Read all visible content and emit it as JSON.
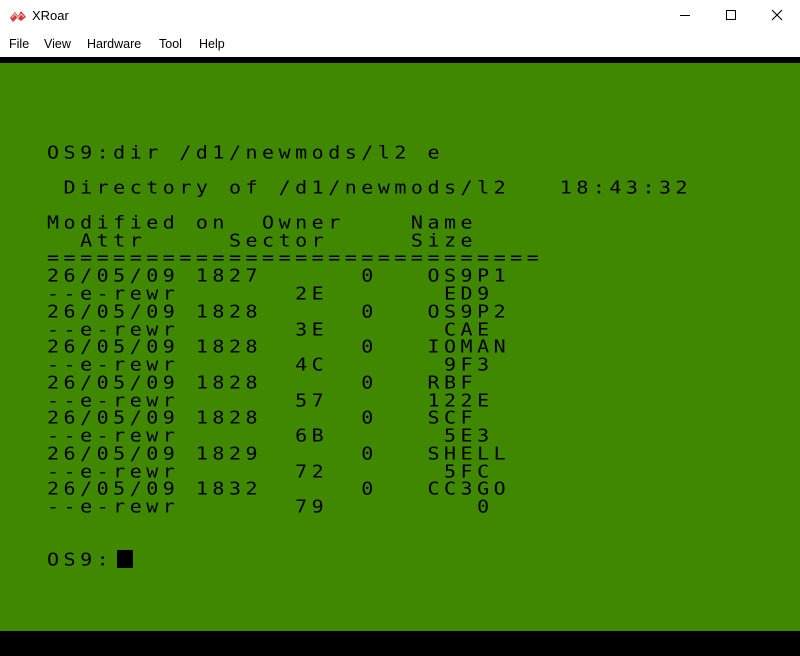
{
  "window": {
    "title": "XRoar",
    "icon": "xroar-app-icon",
    "controls": [
      "minimize-icon",
      "maximize-icon",
      "close-icon"
    ]
  },
  "menu": [
    "File",
    "View",
    "Hardware",
    "Tool",
    "Help"
  ],
  "screen": {
    "background_color": "#3f8800",
    "text_color": "#000000",
    "lines": [
      "OS9:dir /d1/newmods/l2 e",
      " Directory of /d1/newmods/l2   18:43:32",
      "Modified on  Owner    Name",
      "  Attr     Sector     Size",
      "==============================",
      "26/05/09 1827      0   OS9P1",
      "--e-rewr       2E       ED9",
      "26/05/09 1828      0   OS9P2",
      "--e-rewr       3E       CAE",
      "26/05/09 1828      0   IOMAN",
      "--e-rewr       4C       9F3",
      "26/05/09 1828      0   RBF",
      "--e-rewr       57      122E",
      "26/05/09 1828      0   SCF",
      "--e-rewr       6B       5E3",
      "26/05/09 1829      0   SHELL",
      "--e-rewr       72       5FC",
      "26/05/09 1832      0   CC3GO",
      "--e-rewr       79         0"
    ],
    "prompt": "OS9:"
  }
}
